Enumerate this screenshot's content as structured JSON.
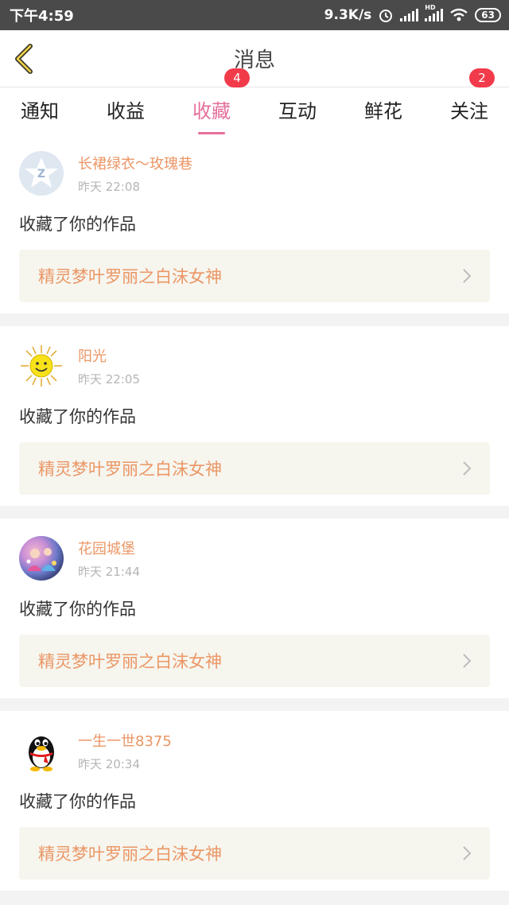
{
  "status": {
    "time": "下午4:59",
    "speed": "9.3K/s",
    "hd": "HD",
    "battery": "63"
  },
  "header": {
    "title": "消息"
  },
  "tabs": [
    {
      "label": "通知"
    },
    {
      "label": "收益"
    },
    {
      "label": "收藏",
      "badge": "4"
    },
    {
      "label": "互动"
    },
    {
      "label": "鲜花"
    },
    {
      "label": "关注",
      "badge": "2"
    }
  ],
  "items": [
    {
      "name": "长裙绿衣〜玫瑰巷",
      "time": "昨天 22:08",
      "action": "收藏了你的作品",
      "work": "精灵梦叶罗丽之白沫女神",
      "avatar": "default-avatar"
    },
    {
      "name": "阳光",
      "time": "昨天 22:05",
      "action": "收藏了你的作品",
      "work": "精灵梦叶罗丽之白沫女神",
      "avatar": "sun-avatar"
    },
    {
      "name": "花园城堡",
      "time": "昨天 21:44",
      "action": "收藏了你的作品",
      "work": "精灵梦叶罗丽之白沫女神",
      "avatar": "photo-avatar"
    },
    {
      "name": "一生一世8375",
      "time": "昨天 20:34",
      "action": "收藏了你的作品",
      "work": "精灵梦叶罗丽之白沫女神",
      "avatar": "penguin-avatar"
    }
  ]
}
